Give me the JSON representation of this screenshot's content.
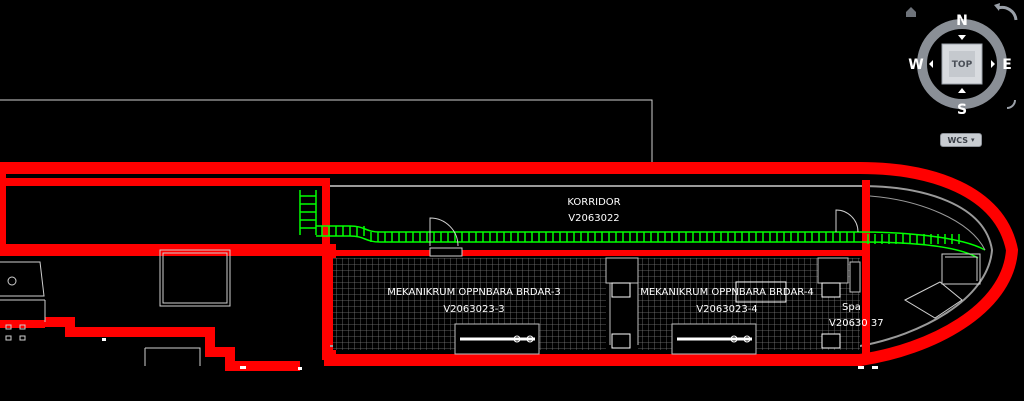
{
  "drawing": {
    "corridor_label": "KORRIDOR",
    "corridor_id": "V2063022",
    "room1_label": "MEKANIKRUM OPPNBARA BRDAR-3",
    "room1_id": "V2063023-3",
    "room2_label": "MEKANIKRUM OPPNBARA BRDAR-4",
    "room2_id": "V2063023-4",
    "space_label": "Spa",
    "space_id": "V20630 37"
  },
  "viewcube": {
    "north": "N",
    "south": "S",
    "east": "E",
    "west": "W",
    "face": "TOP"
  },
  "wcs": {
    "label": "WCS",
    "caret": "▾"
  },
  "colors": {
    "background": "#000000",
    "hull": "#ff0000",
    "ladder": "#00ff00",
    "lines": "#ffffff",
    "grating": "#808080"
  }
}
